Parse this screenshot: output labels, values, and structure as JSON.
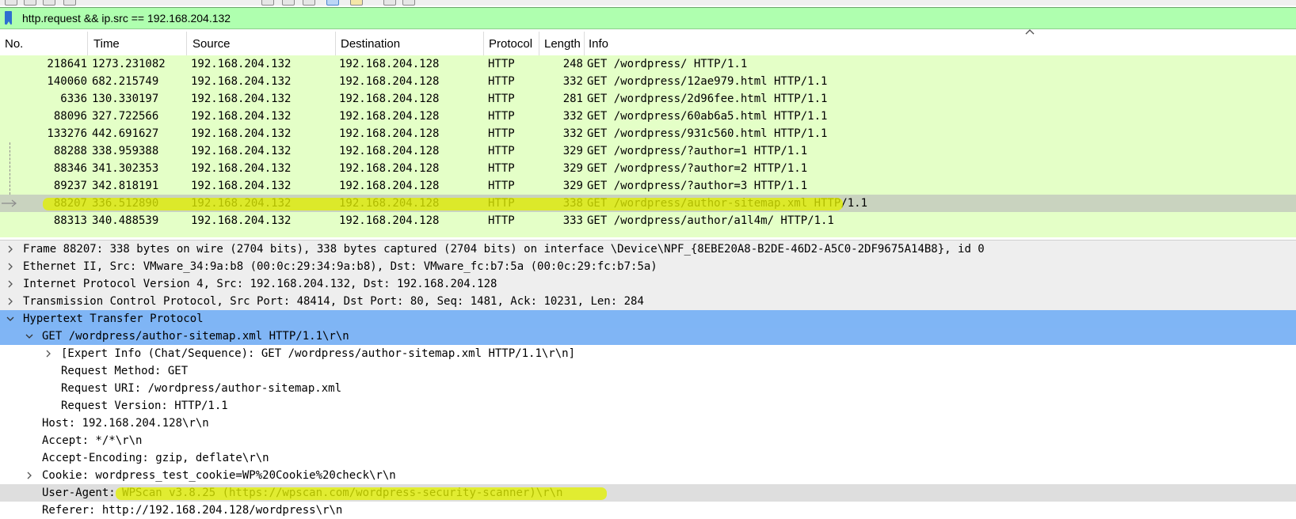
{
  "filter": {
    "value": "http.request && ip.src == 192.168.204.132"
  },
  "columns": [
    "No.",
    "Time",
    "Source",
    "Destination",
    "Protocol",
    "Length",
    "Info"
  ],
  "packets": [
    {
      "no": "218641",
      "time": "1273.231082",
      "src": "192.168.204.132",
      "dst": "192.168.204.128",
      "proto": "HTTP",
      "len": "248",
      "info": "GET /wordpress/ HTTP/1.1"
    },
    {
      "no": "140060",
      "time": "682.215749",
      "src": "192.168.204.132",
      "dst": "192.168.204.128",
      "proto": "HTTP",
      "len": "332",
      "info": "GET /wordpress/12ae979.html HTTP/1.1"
    },
    {
      "no": "6336",
      "time": "130.330197",
      "src": "192.168.204.132",
      "dst": "192.168.204.128",
      "proto": "HTTP",
      "len": "281",
      "info": "GET /wordpress/2d96fee.html HTTP/1.1"
    },
    {
      "no": "88096",
      "time": "327.722566",
      "src": "192.168.204.132",
      "dst": "192.168.204.128",
      "proto": "HTTP",
      "len": "332",
      "info": "GET /wordpress/60ab6a5.html HTTP/1.1"
    },
    {
      "no": "133276",
      "time": "442.691627",
      "src": "192.168.204.132",
      "dst": "192.168.204.128",
      "proto": "HTTP",
      "len": "332",
      "info": "GET /wordpress/931c560.html HTTP/1.1"
    },
    {
      "no": "88288",
      "time": "338.959388",
      "src": "192.168.204.132",
      "dst": "192.168.204.128",
      "proto": "HTTP",
      "len": "329",
      "info": "GET /wordpress/?author=1 HTTP/1.1"
    },
    {
      "no": "88346",
      "time": "341.302353",
      "src": "192.168.204.132",
      "dst": "192.168.204.128",
      "proto": "HTTP",
      "len": "329",
      "info": "GET /wordpress/?author=2 HTTP/1.1"
    },
    {
      "no": "89237",
      "time": "342.818191",
      "src": "192.168.204.132",
      "dst": "192.168.204.128",
      "proto": "HTTP",
      "len": "329",
      "info": "GET /wordpress/?author=3 HTTP/1.1"
    },
    {
      "no": "88207",
      "time": "336.512890",
      "src": "192.168.204.132",
      "dst": "192.168.204.128",
      "proto": "HTTP",
      "len": "338",
      "info": "GET /wordpress/author-sitemap.xml HTTP/1.1"
    },
    {
      "no": "88313",
      "time": "340.488539",
      "src": "192.168.204.132",
      "dst": "192.168.204.128",
      "proto": "HTTP",
      "len": "333",
      "info": "GET /wordpress/author/a1l4m/ HTTP/1.1"
    }
  ],
  "details": [
    {
      "text": "Frame 88207: 338 bytes on wire (2704 bits), 338 bytes captured (2704 bits) on interface \\Device\\NPF_{8EBE20A8-B2DE-46D2-A5C0-2DF9675A14B8}, id 0"
    },
    {
      "text": "Ethernet II, Src: VMware_34:9a:b8 (00:0c:29:34:9a:b8), Dst: VMware_fc:b7:5a (00:0c:29:fc:b7:5a)"
    },
    {
      "text": "Internet Protocol Version 4, Src: 192.168.204.132, Dst: 192.168.204.128"
    },
    {
      "text": "Transmission Control Protocol, Src Port: 48414, Dst Port: 80, Seq: 1481, Ack: 10231, Len: 284"
    },
    {
      "text": "Hypertext Transfer Protocol"
    },
    {
      "text": "GET /wordpress/author-sitemap.xml HTTP/1.1\\r\\n"
    },
    {
      "text": "[Expert Info (Chat/Sequence): GET /wordpress/author-sitemap.xml HTTP/1.1\\r\\n]"
    },
    {
      "text": "Request Method: GET"
    },
    {
      "text": "Request URI: /wordpress/author-sitemap.xml"
    },
    {
      "text": "Request Version: HTTP/1.1"
    },
    {
      "text": "Host: 192.168.204.128\\r\\n"
    },
    {
      "text": "Accept: */*\\r\\n"
    },
    {
      "text": "Accept-Encoding: gzip, deflate\\r\\n"
    },
    {
      "text": "Cookie: wordpress_test_cookie=WP%20Cookie%20check\\r\\n"
    },
    {
      "text": "User-Agent: WPScan v3.8.25 (https://wpscan.com/wordpress-security-scanner)\\r\\n"
    },
    {
      "text": "Referer: http://192.168.204.128/wordpress\\r\\n"
    }
  ]
}
